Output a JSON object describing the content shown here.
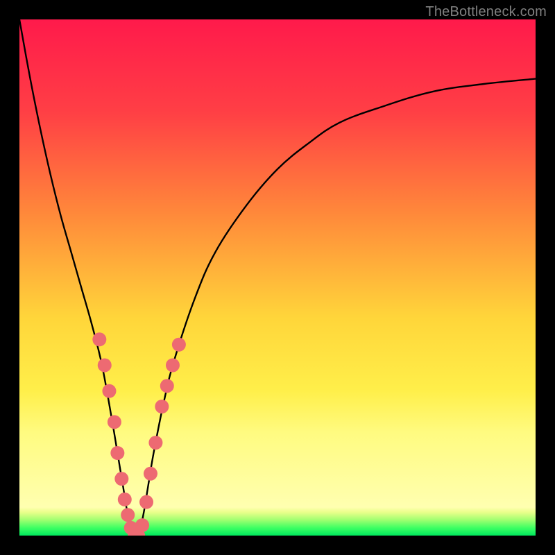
{
  "watermark": "TheBottleneck.com",
  "chart_data": {
    "type": "line",
    "title": "",
    "xlabel": "",
    "ylabel": "",
    "xlim": [
      0,
      100
    ],
    "ylim": [
      0,
      100
    ],
    "gradient_stops": [
      {
        "offset": 0.0,
        "color": "#ff1a4b"
      },
      {
        "offset": 0.18,
        "color": "#ff3f45"
      },
      {
        "offset": 0.38,
        "color": "#ff8a3a"
      },
      {
        "offset": 0.58,
        "color": "#ffd63a"
      },
      {
        "offset": 0.72,
        "color": "#ffef4a"
      },
      {
        "offset": 0.8,
        "color": "#fffb80"
      },
      {
        "offset": 0.945,
        "color": "#ffffb0"
      },
      {
        "offset": 0.955,
        "color": "#e9ff8a"
      },
      {
        "offset": 0.97,
        "color": "#9eff70"
      },
      {
        "offset": 0.985,
        "color": "#3eff63"
      },
      {
        "offset": 1.0,
        "color": "#00e85e"
      }
    ],
    "series": [
      {
        "name": "bottleneck-curve",
        "x": [
          0,
          2,
          4,
          6,
          8,
          10,
          12,
          14,
          16,
          18,
          19,
          20,
          21,
          22,
          23,
          24,
          25,
          26,
          28,
          30,
          34,
          38,
          44,
          50,
          56,
          62,
          70,
          80,
          90,
          100
        ],
        "y": [
          100,
          89,
          79,
          70,
          62,
          55,
          48,
          41,
          33,
          22,
          16,
          10,
          4,
          0,
          0,
          4,
          10,
          16,
          26,
          34,
          46,
          55,
          64,
          71,
          76,
          80,
          83,
          86,
          87.5,
          88.5
        ]
      }
    ],
    "markers": [
      {
        "x": 15.5,
        "y": 38
      },
      {
        "x": 16.5,
        "y": 33
      },
      {
        "x": 17.4,
        "y": 28
      },
      {
        "x": 18.4,
        "y": 22
      },
      {
        "x": 19.0,
        "y": 16
      },
      {
        "x": 19.8,
        "y": 11
      },
      {
        "x": 20.4,
        "y": 7
      },
      {
        "x": 21.0,
        "y": 4
      },
      {
        "x": 21.6,
        "y": 1.5
      },
      {
        "x": 22.3,
        "y": 0
      },
      {
        "x": 23.0,
        "y": 0
      },
      {
        "x": 23.8,
        "y": 2
      },
      {
        "x": 24.6,
        "y": 6.5
      },
      {
        "x": 25.4,
        "y": 12
      },
      {
        "x": 26.4,
        "y": 18
      },
      {
        "x": 27.6,
        "y": 25
      },
      {
        "x": 28.6,
        "y": 29
      },
      {
        "x": 29.7,
        "y": 33
      },
      {
        "x": 30.9,
        "y": 37
      }
    ],
    "marker_color": "#ed6a72",
    "marker_radius": 10
  }
}
